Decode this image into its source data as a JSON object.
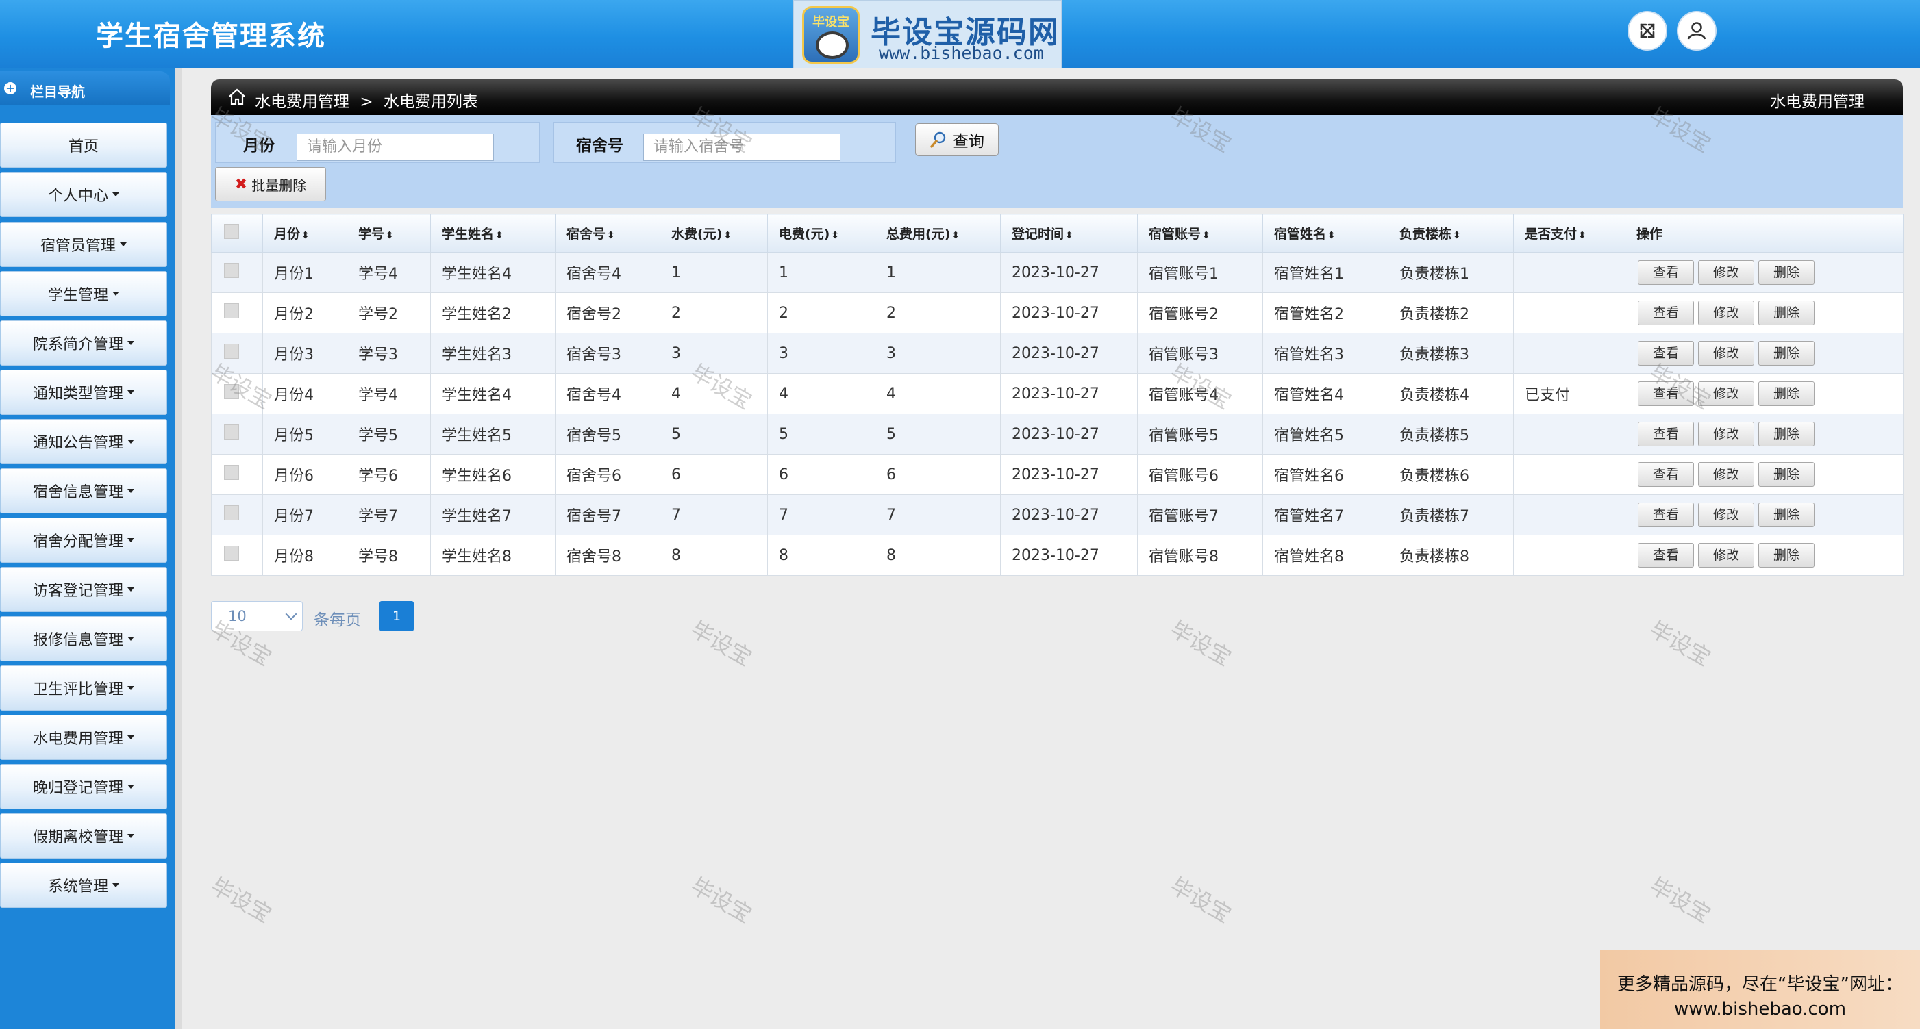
{
  "header": {
    "title": "学生宿舍管理系统",
    "logo": {
      "badge_text": "毕设宝",
      "name": "毕设宝源码网",
      "url": "www.bishebao.com"
    }
  },
  "sidebar": {
    "heading": "栏目导航",
    "items": [
      {
        "label": "首页",
        "has_caret": false
      },
      {
        "label": "个人中心",
        "has_caret": true
      },
      {
        "label": "宿管员管理",
        "has_caret": true
      },
      {
        "label": "学生管理",
        "has_caret": true
      },
      {
        "label": "院系简介管理",
        "has_caret": true
      },
      {
        "label": "通知类型管理",
        "has_caret": true
      },
      {
        "label": "通知公告管理",
        "has_caret": true
      },
      {
        "label": "宿舍信息管理",
        "has_caret": true
      },
      {
        "label": "宿舍分配管理",
        "has_caret": true
      },
      {
        "label": "访客登记管理",
        "has_caret": true
      },
      {
        "label": "报修信息管理",
        "has_caret": true
      },
      {
        "label": "卫生评比管理",
        "has_caret": true
      },
      {
        "label": "水电费用管理",
        "has_caret": true
      },
      {
        "label": "晚归登记管理",
        "has_caret": true
      },
      {
        "label": "假期离校管理",
        "has_caret": true
      },
      {
        "label": "系统管理",
        "has_caret": true
      }
    ]
  },
  "breadcrumb": {
    "parent": "水电费用管理",
    "sep": ">",
    "current": "水电费用列表",
    "right": "水电费用管理"
  },
  "search": {
    "month_label": "月份",
    "month_placeholder": "请输入月份",
    "room_label": "宿舍号",
    "room_placeholder": "请输入宿舍号",
    "query_label": "查询"
  },
  "batch_delete_label": "批量删除",
  "table": {
    "columns": [
      "月份",
      "学号",
      "学生姓名",
      "宿舍号",
      "水费(元)",
      "电费(元)",
      "总费用(元)",
      "登记时间",
      "宿管账号",
      "宿管姓名",
      "负责楼栋",
      "是否支付",
      "操作"
    ],
    "sort_mark": "⬍",
    "actions": [
      "查看",
      "修改",
      "删除"
    ],
    "rows": [
      [
        "月份1",
        "学号4",
        "学生姓名4",
        "宿舍号4",
        "1",
        "1",
        "1",
        "2023-10-27",
        "宿管账号1",
        "宿管姓名1",
        "负责楼栋1",
        ""
      ],
      [
        "月份2",
        "学号2",
        "学生姓名2",
        "宿舍号2",
        "2",
        "2",
        "2",
        "2023-10-27",
        "宿管账号2",
        "宿管姓名2",
        "负责楼栋2",
        ""
      ],
      [
        "月份3",
        "学号3",
        "学生姓名3",
        "宿舍号3",
        "3",
        "3",
        "3",
        "2023-10-27",
        "宿管账号3",
        "宿管姓名3",
        "负责楼栋3",
        ""
      ],
      [
        "月份4",
        "学号4",
        "学生姓名4",
        "宿舍号4",
        "4",
        "4",
        "4",
        "2023-10-27",
        "宿管账号4",
        "宿管姓名4",
        "负责楼栋4",
        "已支付"
      ],
      [
        "月份5",
        "学号5",
        "学生姓名5",
        "宿舍号5",
        "5",
        "5",
        "5",
        "2023-10-27",
        "宿管账号5",
        "宿管姓名5",
        "负责楼栋5",
        ""
      ],
      [
        "月份6",
        "学号6",
        "学生姓名6",
        "宿舍号6",
        "6",
        "6",
        "6",
        "2023-10-27",
        "宿管账号6",
        "宿管姓名6",
        "负责楼栋6",
        ""
      ],
      [
        "月份7",
        "学号7",
        "学生姓名7",
        "宿舍号7",
        "7",
        "7",
        "7",
        "2023-10-27",
        "宿管账号7",
        "宿管姓名7",
        "负责楼栋7",
        ""
      ],
      [
        "月份8",
        "学号8",
        "学生姓名8",
        "宿舍号8",
        "8",
        "8",
        "8",
        "2023-10-27",
        "宿管账号8",
        "宿管姓名8",
        "负责楼栋8",
        ""
      ]
    ]
  },
  "pagination": {
    "page_size": "10",
    "per_page_label": "条每页",
    "current_page": "1"
  },
  "watermark": "毕设宝",
  "promo": {
    "line1": "更多精品源码，尽在“毕设宝”网址：",
    "line2": "www.bishebao.com"
  },
  "colors": {
    "header_blue": "#1e8fe3",
    "sidebar_blue": "#1d85d8",
    "search_bg": "#b9d4f3",
    "page_active": "#1a7fd6"
  },
  "icons": [
    "fullscreen-icon",
    "user-icon",
    "home-icon",
    "search-icon",
    "close-icon",
    "chevron-down-icon"
  ]
}
